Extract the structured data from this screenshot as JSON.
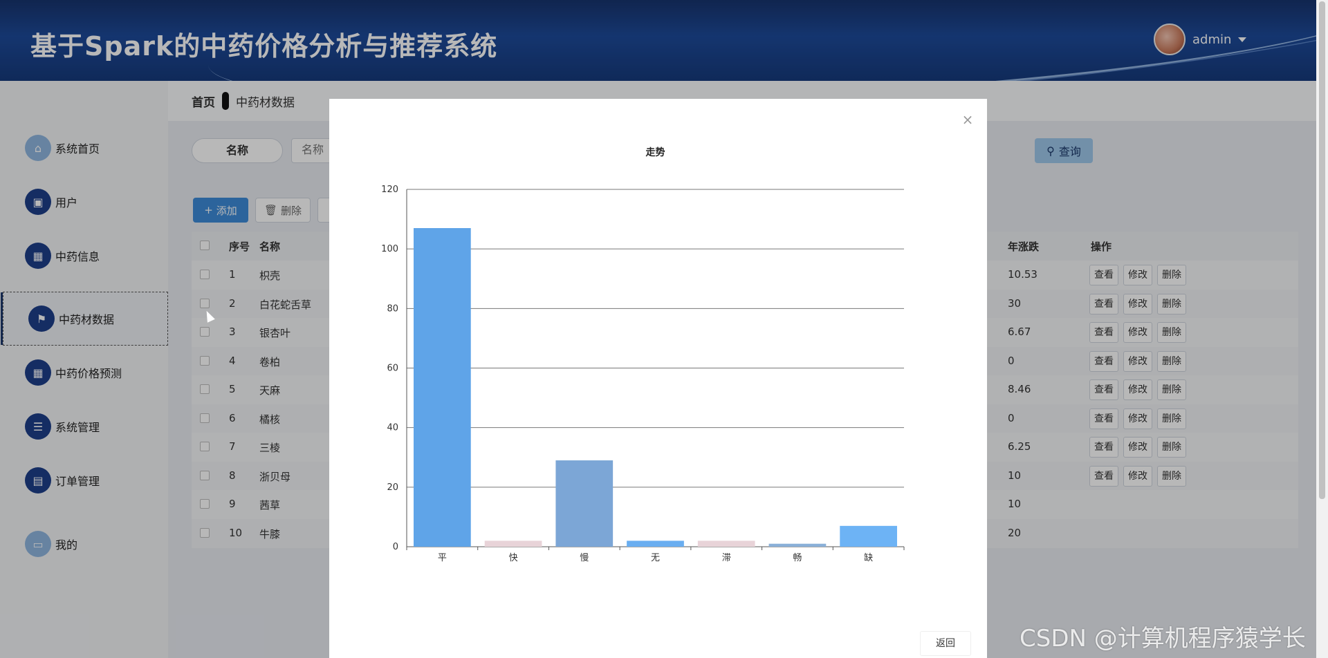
{
  "header": {
    "title": "基于Spark的中药价格分析与推荐系统",
    "username": "admin"
  },
  "sidebar": {
    "items": [
      {
        "label": "系统首页",
        "icon": "home-icon"
      },
      {
        "label": "用户",
        "icon": "clipboard-icon"
      },
      {
        "label": "中药信息",
        "icon": "grid-icon"
      },
      {
        "label": "中药材数据",
        "icon": "flag-icon",
        "active": true
      },
      {
        "label": "中药价格预测",
        "icon": "apps-icon"
      },
      {
        "label": "系统管理",
        "icon": "sliders-icon"
      },
      {
        "label": "订单管理",
        "icon": "document-icon"
      },
      {
        "label": "我的",
        "icon": "card-icon"
      }
    ]
  },
  "breadcrumb": {
    "home": "首页",
    "current": "中药材数据"
  },
  "search": {
    "label": "名称",
    "placeholder": "名称",
    "query_button": "查询"
  },
  "toolbar": {
    "add": "添加",
    "delete": "删除"
  },
  "table": {
    "headers": {
      "index": "序号",
      "name": "名称",
      "change": "年涨跌",
      "ops": "操作"
    },
    "rows": [
      {
        "index": "1",
        "name": "枳壳",
        "change": "10.53"
      },
      {
        "index": "2",
        "name": "白花蛇舌草",
        "change": "30"
      },
      {
        "index": "3",
        "name": "银杏叶",
        "change": "6.67"
      },
      {
        "index": "4",
        "name": "卷柏",
        "change": "0"
      },
      {
        "index": "5",
        "name": "天麻",
        "change": "8.46"
      },
      {
        "index": "6",
        "name": "橘核",
        "change": "0"
      },
      {
        "index": "7",
        "name": "三棱",
        "change": "6.25"
      },
      {
        "index": "8",
        "name": "浙贝母",
        "change": "10"
      },
      {
        "index": "9",
        "name": "茜草",
        "change": "10"
      },
      {
        "index": "10",
        "name": "牛膝",
        "change": "20"
      }
    ],
    "ops": {
      "view": "查看",
      "edit": "修改",
      "delete": "删除"
    }
  },
  "modal": {
    "close": "×",
    "back_button": "返回"
  },
  "chart_data": {
    "type": "bar",
    "title": "走势",
    "categories": [
      "平",
      "快",
      "慢",
      "无",
      "滞",
      "畅",
      "缺"
    ],
    "values": [
      107,
      2,
      29,
      2,
      2,
      1,
      7
    ],
    "ylim": [
      0,
      120
    ],
    "yticks": [
      0,
      20,
      40,
      60,
      80,
      100,
      120
    ],
    "grid": true,
    "colors": [
      "#5fa4e8",
      "#e8d3d8",
      "#7ca6d6",
      "#6aaef0",
      "#e8d3d8",
      "#8ab0d8",
      "#6db3f5"
    ]
  },
  "watermark": "CSDN @计算机程序猿学长"
}
